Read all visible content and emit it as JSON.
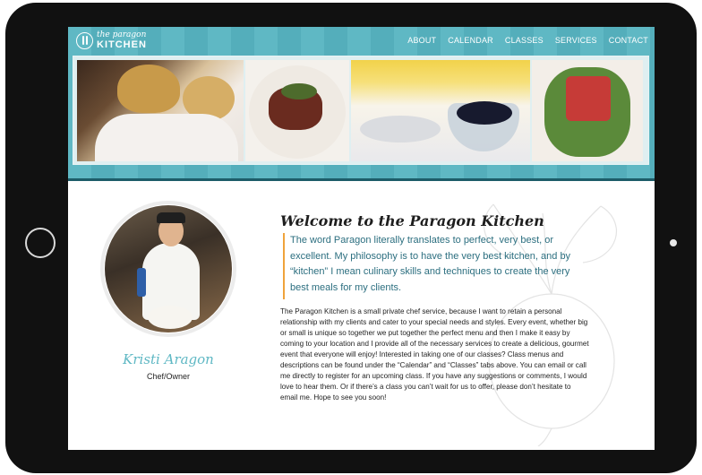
{
  "site": {
    "logo": {
      "script": "the paragon",
      "name": "KITCHEN"
    },
    "nav": [
      {
        "label": "ABOUT"
      },
      {
        "label": "CALENDAR"
      },
      {
        "label": "CLASSES"
      },
      {
        "label": "SERVICES"
      },
      {
        "label": "CONTACT"
      }
    ]
  },
  "hero": {
    "photos": [
      "chefs-cooking",
      "sliced-steak-plate",
      "berries-in-glass-bowl",
      "tomato-salad-plate"
    ]
  },
  "profile": {
    "name": "Kristi Aragon",
    "role": "Chef/Owner"
  },
  "welcome": {
    "title": "Welcome to the Paragon Kitchen",
    "quote": "The word Paragon literally translates to perfect, very best, or excellent. My philosophy is to have the very best kitchen, and by “kitchen” I mean culinary skills and techniques to create the very best meals for my clients.",
    "body": "The Paragon Kitchen is a small private chef service, because I want to retain a personal relationship with my clients and cater to your special needs and styles. Every event, whether big or small is unique so together we put together the perfect menu and then I make it easy by coming to your location and I provide all of the necessary services to create a delicious, gourmet event that everyone will enjoy! Interested in taking one of our classes? Class menus and descriptions can be found under the “Calendar” and “Classes” tabs above. You can email or call me directly to register for an upcoming class. If you have any suggestions or comments, I would love to hear them. Or if there’s a class you can’t wait for us to offer, please don’t hesitate to email me. Hope to see you soon!"
  },
  "colors": {
    "header_teal": "#5fb8c4",
    "header_border": "#1d5d69",
    "quote_text": "#2b6e7f",
    "quote_accent": "#f0a33c",
    "name_script": "#5fb8c4",
    "device_frame": "#111111"
  }
}
